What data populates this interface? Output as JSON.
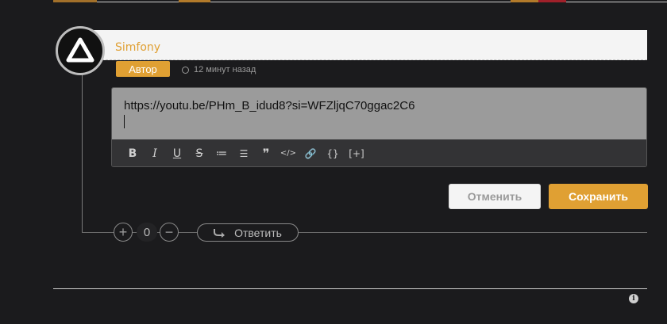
{
  "colors": {
    "accent": "#e0a033",
    "background": "#1b1b1d"
  },
  "comment": {
    "author": "Simfony",
    "badge": "Автор",
    "time": "12 минут назад"
  },
  "editor": {
    "text": "https://youtu.be/PHm_B_idud8?si=WFZljqC70ggac2C6",
    "toolbar": [
      {
        "name": "bold-icon",
        "glyph": "B"
      },
      {
        "name": "italic-icon",
        "glyph": "I"
      },
      {
        "name": "underline-icon",
        "glyph": "U"
      },
      {
        "name": "strikethrough-icon",
        "glyph": "S"
      },
      {
        "name": "ordered-list-icon",
        "glyph": "≔"
      },
      {
        "name": "bullet-list-icon",
        "glyph": "☰"
      },
      {
        "name": "quote-icon",
        "glyph": "❞"
      },
      {
        "name": "code-icon",
        "glyph": "</>"
      },
      {
        "name": "link-icon",
        "glyph": "🔗"
      },
      {
        "name": "code-block-icon",
        "glyph": "{}"
      },
      {
        "name": "spoiler-icon",
        "glyph": "[+]"
      }
    ]
  },
  "actions": {
    "cancel": "Отменить",
    "save": "Сохранить"
  },
  "votes": {
    "plus": "+",
    "count": "0",
    "minus": "−"
  },
  "reply": {
    "label": "Ответить"
  },
  "footer": {
    "info_icon": "i"
  }
}
